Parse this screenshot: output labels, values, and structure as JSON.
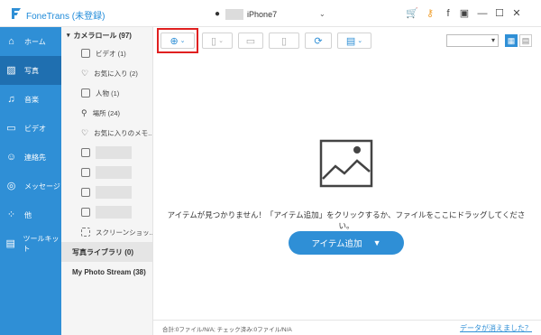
{
  "app": {
    "title": "FoneTrans (未登録)",
    "brand_color": "#2f8fd6"
  },
  "device": {
    "name": "iPhone7"
  },
  "titlebar_icons": [
    {
      "name": "cart-icon",
      "glyph": "🛒",
      "color": "#f0a030"
    },
    {
      "name": "key-icon",
      "glyph": "⚷",
      "color": "#f0a030"
    },
    {
      "name": "facebook-icon",
      "glyph": "f",
      "color": "#444"
    },
    {
      "name": "chat-icon",
      "glyph": "▣",
      "color": "#444"
    },
    {
      "name": "minimize-icon",
      "glyph": "—",
      "color": "#444"
    },
    {
      "name": "maximize-icon",
      "glyph": "☐",
      "color": "#444"
    },
    {
      "name": "close-icon",
      "glyph": "✕",
      "color": "#444"
    }
  ],
  "sidebar": {
    "items": [
      {
        "label": "ホーム",
        "icon": "home-icon",
        "glyph": "⌂"
      },
      {
        "label": "写真",
        "icon": "photo-icon",
        "glyph": "▨"
      },
      {
        "label": "音楽",
        "icon": "music-icon",
        "glyph": "♫"
      },
      {
        "label": "ビデオ",
        "icon": "video-icon",
        "glyph": "▭"
      },
      {
        "label": "連絡先",
        "icon": "contacts-icon",
        "glyph": "☺"
      },
      {
        "label": "メッセージ",
        "icon": "message-icon",
        "glyph": "◎"
      },
      {
        "label": "他",
        "icon": "other-icon",
        "glyph": "⁘"
      },
      {
        "label": "ツールキット",
        "icon": "toolkit-icon",
        "glyph": "▤"
      }
    ],
    "active_index": 1
  },
  "tree": {
    "root": "カメラロール (97)",
    "items": [
      {
        "label": "ビデオ (1)"
      },
      {
        "label": "お気に入り (2)"
      },
      {
        "label": "人物 (1)"
      },
      {
        "label": "場所 (24)"
      },
      {
        "label": "お気に入りのメモ..."
      }
    ],
    "last_item": "スクリーンショッ...",
    "sections": [
      "写真ライブラリ (0)",
      "My Photo Stream (38)"
    ]
  },
  "main": {
    "empty_message": "アイテムが見つかりません！「アイテム追加」をクリックするか、ファイルをここにドラッグしてください。",
    "add_button": "アイテム追加"
  },
  "status": {
    "text": "合計:0ファイル/N/A; チェック済み:0ファイル/N/A",
    "link": "データが消えました？"
  }
}
